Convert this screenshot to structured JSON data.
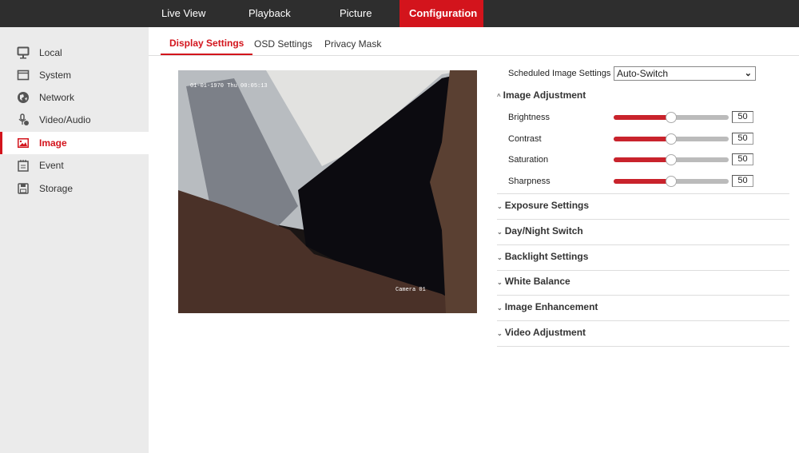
{
  "top_nav": {
    "items": [
      {
        "label": "Live View"
      },
      {
        "label": "Playback"
      },
      {
        "label": "Picture"
      },
      {
        "label": "Configuration",
        "active": true
      }
    ]
  },
  "sidebar": {
    "items": [
      {
        "label": "Local",
        "icon": "monitor-icon"
      },
      {
        "label": "System",
        "icon": "window-icon"
      },
      {
        "label": "Network",
        "icon": "globe-icon"
      },
      {
        "label": "Video/Audio",
        "icon": "microphone-icon"
      },
      {
        "label": "Image",
        "icon": "image-icon",
        "active": true
      },
      {
        "label": "Event",
        "icon": "calendar-icon"
      },
      {
        "label": "Storage",
        "icon": "floppy-disk-icon"
      }
    ]
  },
  "tabs": [
    {
      "label": "Display Settings",
      "active": true
    },
    {
      "label": "OSD Settings"
    },
    {
      "label": "Privacy Mask"
    }
  ],
  "video": {
    "osd_time": "01-01-1970 Thu 00:05:13",
    "osd_name": "Camera 01"
  },
  "settings": {
    "scheduled_label": "Scheduled Image Settings",
    "scheduled_value": "Auto-Switch",
    "image_adjustment": {
      "title": "Image Adjustment",
      "expanded": true,
      "sliders": [
        {
          "label": "Brightness",
          "value": "50"
        },
        {
          "label": "Contrast",
          "value": "50"
        },
        {
          "label": "Saturation",
          "value": "50"
        },
        {
          "label": "Sharpness",
          "value": "50"
        }
      ],
      "range": [
        0,
        100
      ]
    },
    "sections": [
      {
        "title": "Exposure Settings"
      },
      {
        "title": "Day/Night Switch"
      },
      {
        "title": "Backlight Settings"
      },
      {
        "title": "White Balance"
      },
      {
        "title": "Image Enhancement"
      },
      {
        "title": "Video Adjustment"
      }
    ]
  },
  "colors": {
    "accent": "#d3141c",
    "topbar": "#2e2e2e",
    "sidebar": "#ebebeb"
  }
}
